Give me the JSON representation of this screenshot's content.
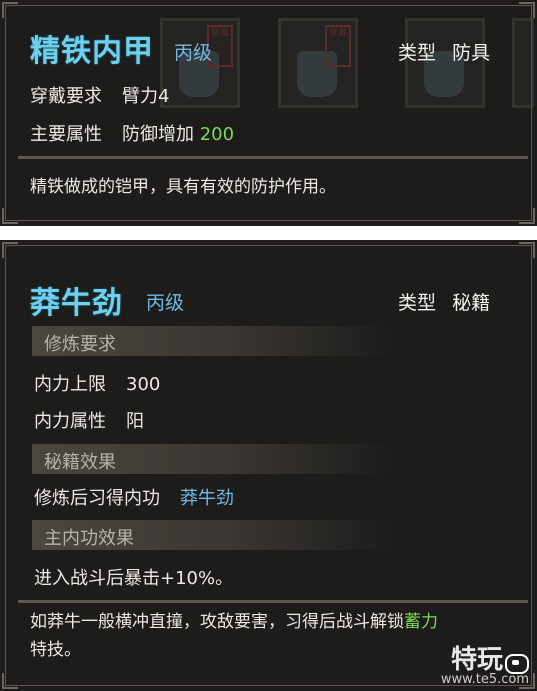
{
  "armor": {
    "name": "精铁内甲",
    "grade": "丙级",
    "type_label": "类型",
    "type_value": "防具",
    "stamp_text": "穿戴",
    "requirement_label": "穿戴要求",
    "requirement_value": "臂力4",
    "main_attr_label": "主要属性",
    "main_attr_name": "防御增加",
    "main_attr_value": "200",
    "description": "精铁做成的铠甲，具有有效的防护作用。"
  },
  "manual": {
    "name": "莽牛劲",
    "grade": "丙级",
    "type_label": "类型",
    "type_value": "秘籍",
    "section_requirements": "修炼要求",
    "neili_cap_label": "内力上限",
    "neili_cap_value": "300",
    "neili_attr_label": "内力属性",
    "neili_attr_value": "阳",
    "section_effects": "秘籍效果",
    "learn_label": "修炼后习得内功",
    "learn_value": "莽牛劲",
    "section_main_effect": "主内功效果",
    "main_effect_text": "进入战斗后暴击+10%。",
    "description_part1": "如莽牛一般横冲直撞，攻敌要害，习得后战斗解锁",
    "description_highlight": "蓄力",
    "description_part2": "特技。"
  },
  "watermark": {
    "text": "特玩",
    "sub": "www.te5.com"
  },
  "colors": {
    "panel_bg": "#1d1c1a",
    "title": "#6fd0ee",
    "grade": "#6fb8e6",
    "positive_value": "#7ed957",
    "divider": "#5a5751"
  },
  "icons": [
    "armor-ghost-icon",
    "seal-stamp-icon",
    "te5-logo-icon"
  ]
}
